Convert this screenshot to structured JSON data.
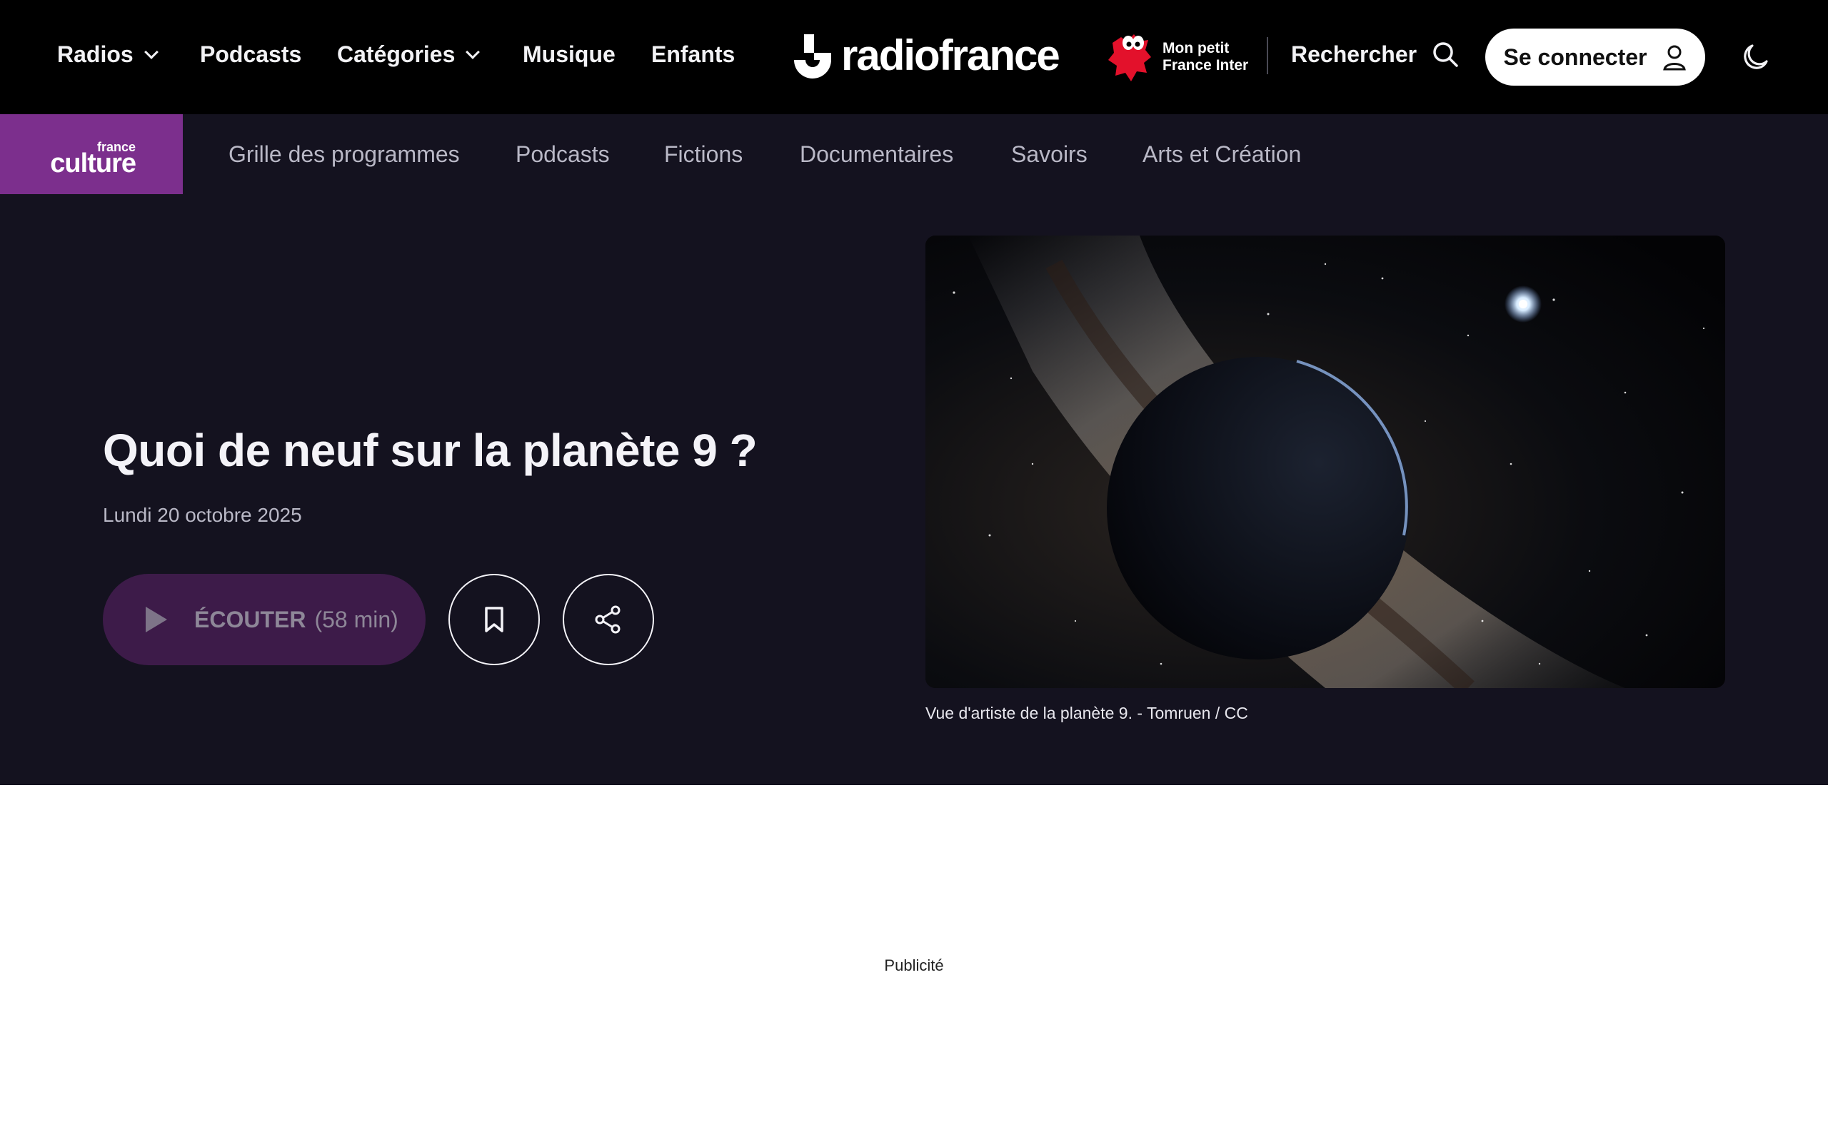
{
  "topnav": {
    "items": [
      {
        "label": "Radios",
        "dropdown": true
      },
      {
        "label": "Podcasts",
        "dropdown": false
      },
      {
        "label": "Catégories",
        "dropdown": true
      },
      {
        "label": "Musique",
        "dropdown": false
      },
      {
        "label": "Enfants",
        "dropdown": false
      }
    ],
    "logo_text": "radiofrance",
    "mpfi_line1": "Mon petit",
    "mpfi_line2": "France Inter",
    "search_label": "Rechercher",
    "connect_label": "Se connecter"
  },
  "station": {
    "logo_small": "france",
    "logo_big": "culture",
    "color": "#7c2f8d",
    "nav": [
      "Grille des programmes",
      "Podcasts",
      "Fictions",
      "Documentaires",
      "Savoirs",
      "Arts et Création"
    ]
  },
  "episode": {
    "title": "Quoi de neuf sur la planète 9 ?",
    "date": "Lundi 20 octobre 2025",
    "listen_label": "ÉCOUTER",
    "duration": "(58 min)",
    "image_caption": "Vue d'artiste de la planète 9. - Tomruen / CC"
  },
  "ad_label": "Publicité",
  "icons": {
    "search": "search-icon",
    "user": "user-icon",
    "theme": "moon-icon",
    "bookmark": "bookmark-icon",
    "share": "share-icon",
    "play": "play-icon"
  }
}
